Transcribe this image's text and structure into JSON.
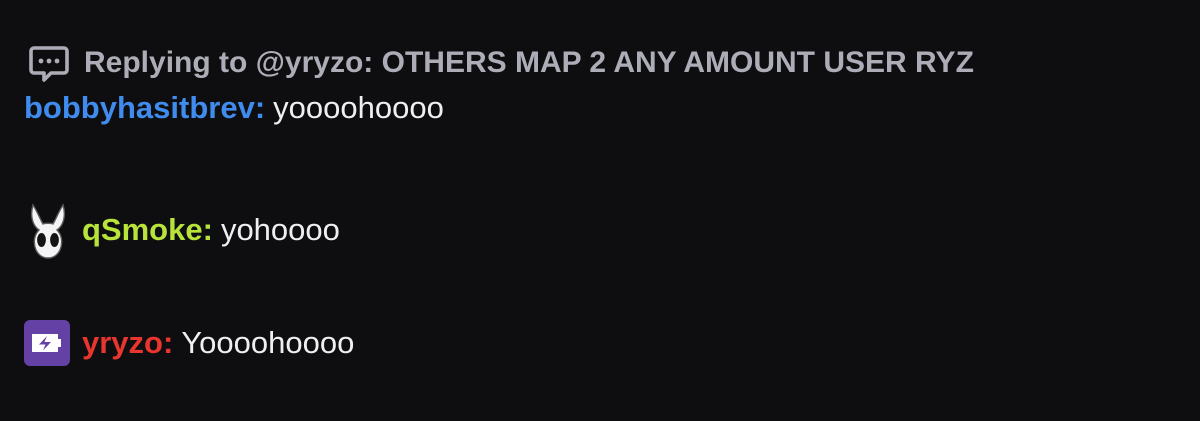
{
  "reply": {
    "icon": "reply-bubble-icon",
    "text": "Replying to @yryzo: OTHERS MAP 2 ANY AMOUNT USER RYZ"
  },
  "messages": [
    {
      "username": "bobbyhasitbrev",
      "colon": ":",
      "text": "yoooohoooo",
      "color": "#3f8cee",
      "badge": null
    },
    {
      "username": "qSmoke",
      "colon": ":",
      "text": "yohoooo",
      "color": "#b8e33a",
      "badge": "hollow-knight-icon"
    },
    {
      "username": "yryzo",
      "colon": ":",
      "text": "Yoooohoooo",
      "color": "#e8362e",
      "badge": "prime-gaming-icon"
    }
  ]
}
